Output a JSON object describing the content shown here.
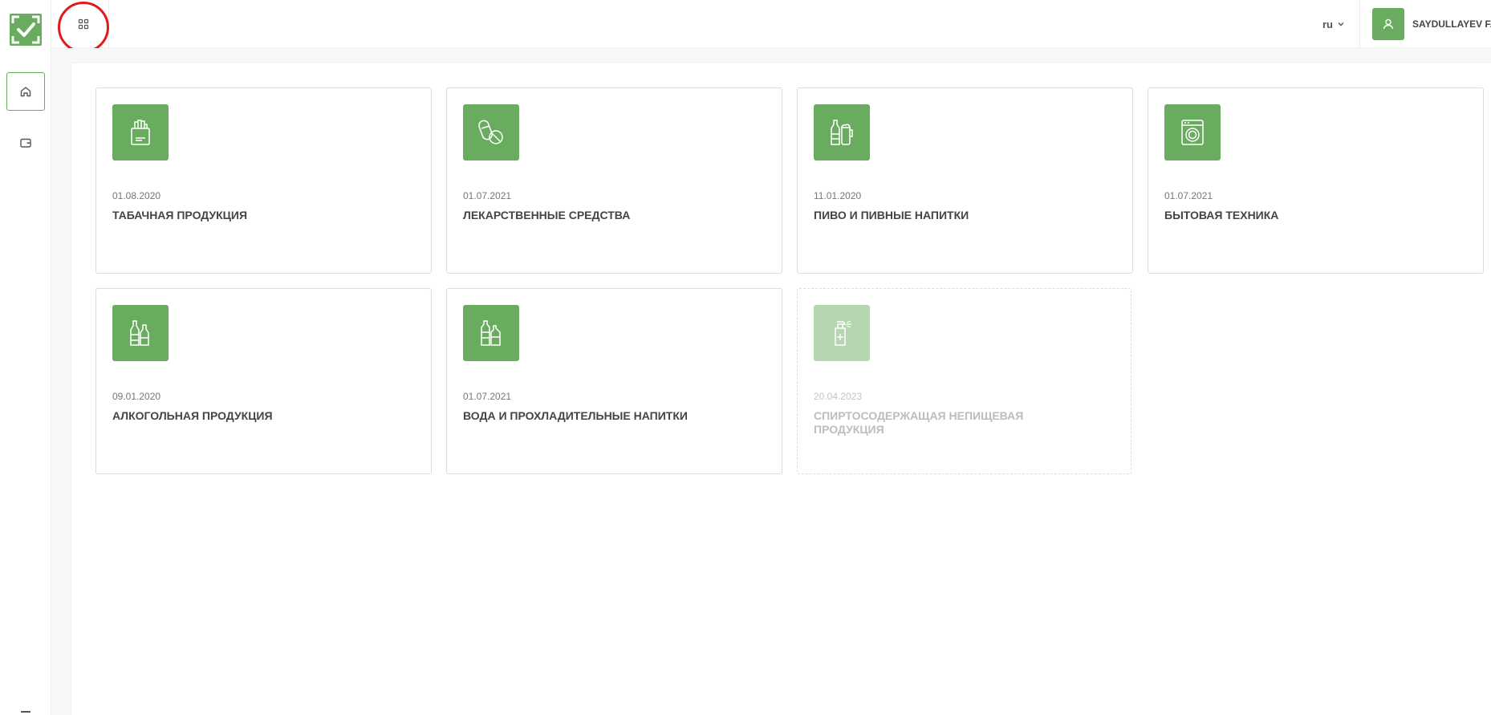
{
  "header": {
    "language": "ru",
    "user_name": "SAYDULLAYEV F. S."
  },
  "sidebar": {
    "items": [
      {
        "name": "home",
        "icon": "home-icon",
        "active": true
      },
      {
        "name": "wallet",
        "icon": "wallet-icon",
        "active": false
      }
    ]
  },
  "colors": {
    "accent": "#6aac5f",
    "accent_disabled": "#b5d6b0",
    "highlight_ring": "#e01b1b"
  },
  "cards": [
    {
      "date": "01.08.2020",
      "title": "ТАБАЧНАЯ ПРОДУКЦИЯ",
      "icon": "cigarette-pack-icon",
      "enabled": true
    },
    {
      "date": "01.07.2021",
      "title": "ЛЕКАРСТВЕННЫЕ СРЕДСТВА",
      "icon": "pill-icon",
      "enabled": true
    },
    {
      "date": "11.01.2020",
      "title": "ПИВО И ПИВНЫЕ НАПИТКИ",
      "icon": "beer-icon",
      "enabled": true
    },
    {
      "date": "01.07.2021",
      "title": "БЫТОВАЯ ТЕХНИКА",
      "icon": "washing-machine-icon",
      "enabled": true
    },
    {
      "date": "09.01.2020",
      "title": "АЛКОГОЛЬНАЯ ПРОДУКЦИЯ",
      "icon": "alcohol-bottles-icon",
      "enabled": true
    },
    {
      "date": "01.07.2021",
      "title": "ВОДА И ПРОХЛАДИТЕЛЬНЫЕ НАПИТКИ",
      "icon": "water-bottles-icon",
      "enabled": true
    },
    {
      "date": "20.04.2023",
      "title": "СПИРТОСОДЕРЖАЩАЯ НЕПИЩЕВАЯ ПРОДУКЦИЯ",
      "icon": "spray-bottle-icon",
      "enabled": false
    }
  ]
}
